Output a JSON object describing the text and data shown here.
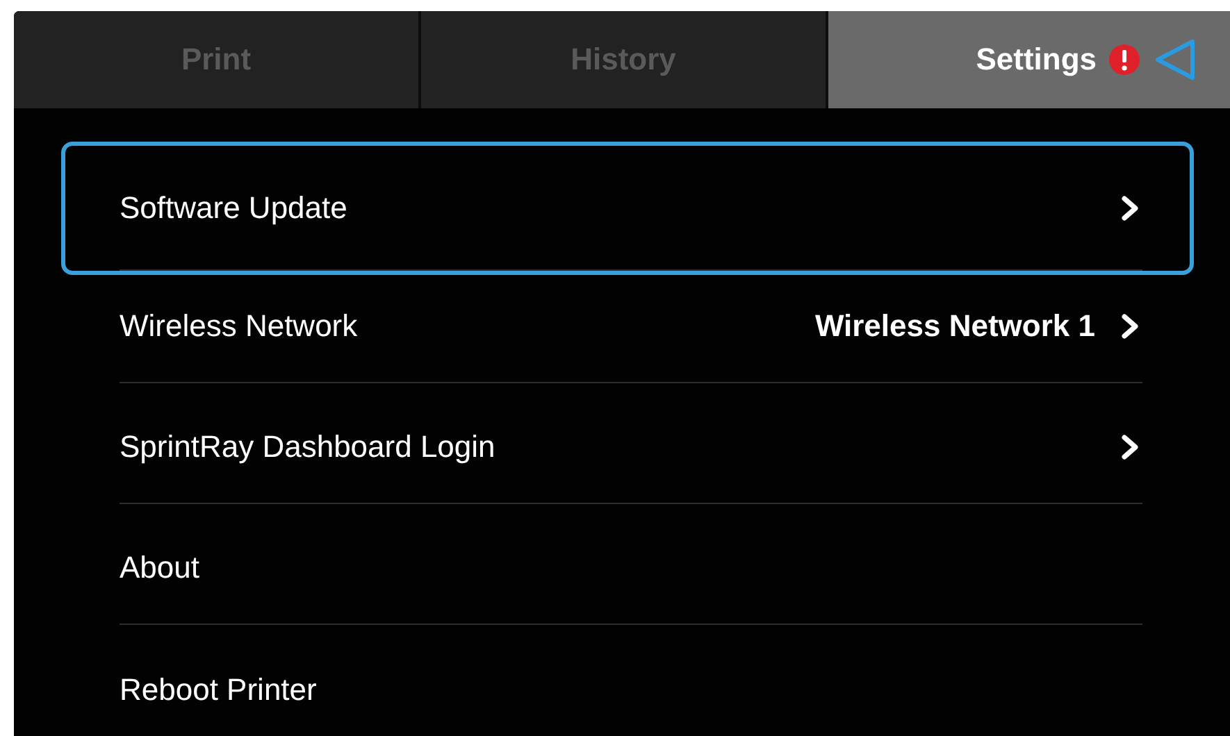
{
  "tabs": [
    {
      "label": "Print",
      "selected": false,
      "alert": false
    },
    {
      "label": "History",
      "selected": false,
      "alert": false
    },
    {
      "label": "Settings",
      "selected": true,
      "alert": true
    }
  ],
  "settings": [
    {
      "label": "Software Update",
      "kind": "nav",
      "selected": true
    },
    {
      "label": "Wireless Network",
      "kind": "nav",
      "value": "Wireless Network 1",
      "selected": false
    },
    {
      "label": "SprintRay Dashboard Login",
      "kind": "nav",
      "selected": false
    },
    {
      "label": "About",
      "kind": "plain",
      "selected": false
    },
    {
      "label": "Reboot Printer",
      "kind": "plain",
      "selected": false
    }
  ]
}
